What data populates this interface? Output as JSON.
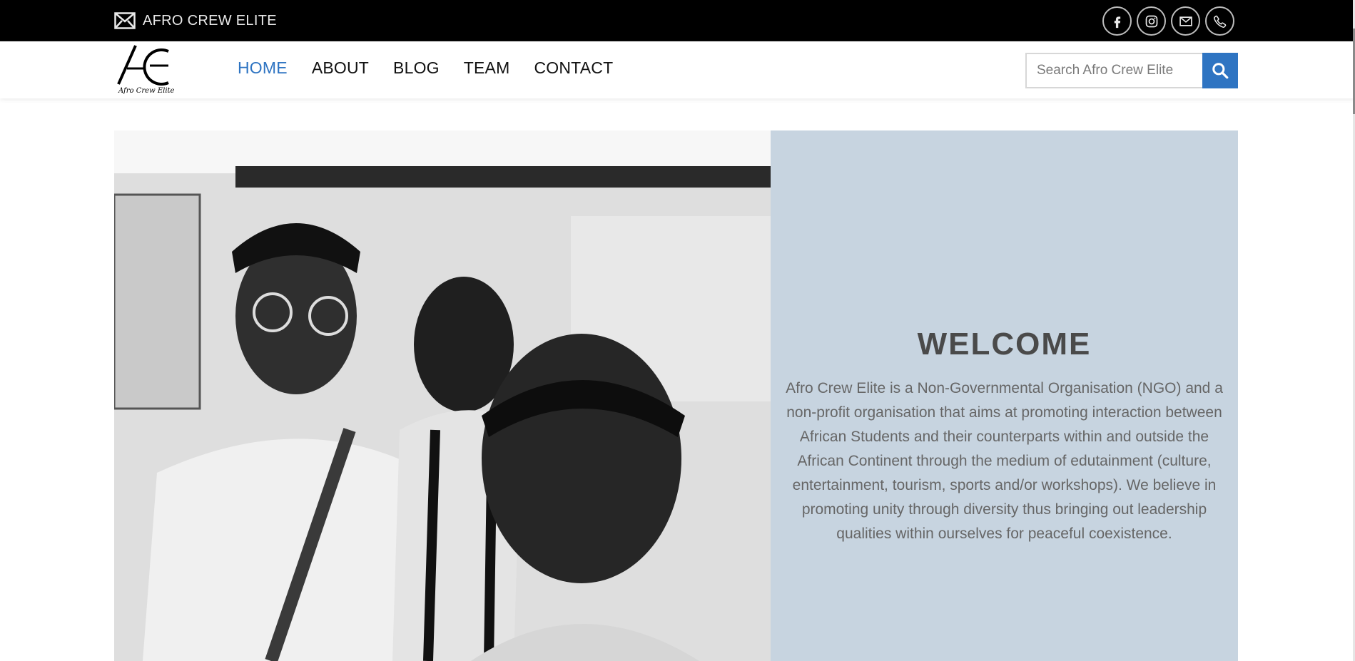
{
  "topbar": {
    "site_label": "AFRO CREW ELITE",
    "icons": [
      "envelope-icon",
      "facebook-icon",
      "instagram-icon",
      "mail-icon",
      "phone-icon"
    ]
  },
  "header": {
    "logo_caption": "Afro Crew Elite",
    "nav": [
      {
        "label": "HOME",
        "active": true
      },
      {
        "label": "ABOUT",
        "active": false
      },
      {
        "label": "BLOG",
        "active": false
      },
      {
        "label": "TEAM",
        "active": false
      },
      {
        "label": "CONTACT",
        "active": false
      }
    ],
    "search": {
      "placeholder": "Search Afro Crew Elite"
    }
  },
  "hero": {
    "title": "WELCOME",
    "text": "Afro Crew Elite is a Non-Governmental Organisation (NGO) and a non-profit organisation that aims at promoting interaction between African Students and their counterparts within and outside the African Continent through the medium of edutainment (culture, entertainment, tourism, sports and/or workshops). We believe in promoting unity through diversity thus bringing out leadership qualities within ourselves for peaceful coexistence."
  },
  "colors": {
    "accent": "#2e74c2",
    "topbar": "#000000",
    "panel": "#c7d4e0",
    "title": "#4a4a4a",
    "body_text": "#666666"
  }
}
